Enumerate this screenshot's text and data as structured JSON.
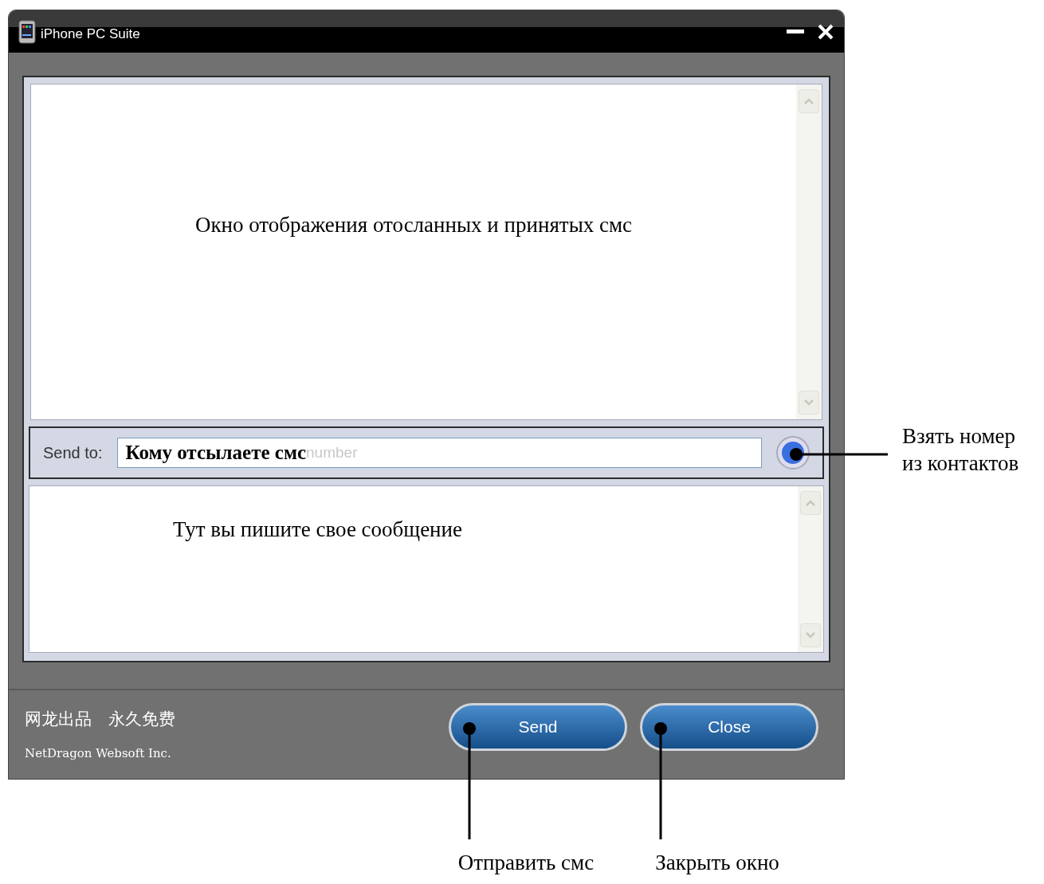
{
  "window": {
    "title": "iPhone PC Suite"
  },
  "message_display": {
    "annotation": "Окно отображения отосланных и принятых смс"
  },
  "send_to": {
    "label": "Send to:",
    "annotation": "Кому отсылаете смс",
    "placeholder": "number"
  },
  "compose": {
    "annotation": "Тут вы пишите свое сообщение"
  },
  "footer": {
    "chinese_text": "网龙出品　永久免费",
    "company": "NetDragon Websoft Inc."
  },
  "buttons": [
    {
      "label": "Send",
      "annotation": "Отправить смс"
    },
    {
      "label": "Close",
      "annotation": "Закрыть окно"
    }
  ],
  "contacts_annotation": [
    "Взять номер",
    "из контактов"
  ]
}
